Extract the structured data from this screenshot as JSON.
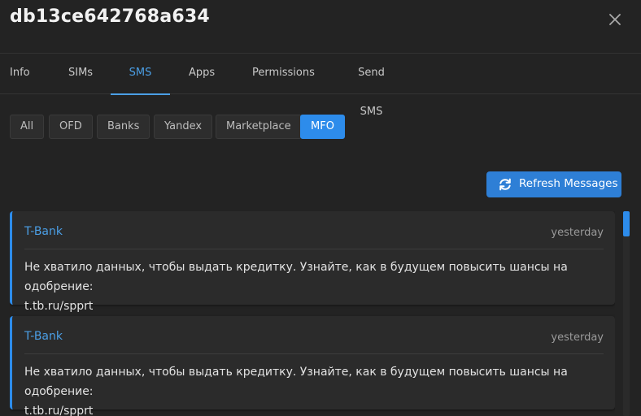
{
  "header": {
    "title": "db13ce642768a634"
  },
  "tabs": [
    {
      "label": "Info"
    },
    {
      "label": "SIMs"
    },
    {
      "label": "SMS"
    },
    {
      "label": "Apps"
    },
    {
      "label": "Permissions"
    },
    {
      "label": "Send SMS"
    }
  ],
  "active_tab": "SMS",
  "filters": [
    {
      "label": "All"
    },
    {
      "label": "OFD"
    },
    {
      "label": "Banks"
    },
    {
      "label": "Yandex"
    },
    {
      "label": "Marketplace"
    },
    {
      "label": "MFO"
    }
  ],
  "active_filter": "MFO",
  "refresh": {
    "label": "Refresh Messages",
    "icon": "refresh-icon"
  },
  "messages": [
    {
      "sender": "T-Bank",
      "time": "yesterday",
      "text_line1": "Не хватило данных, чтобы выдать кредитку. Узнайте, как в будущем повысить шансы на одобрение:",
      "text_line2": "t.tb.ru/spprt"
    },
    {
      "sender": "T-Bank",
      "time": "yesterday",
      "text_line1": "Не хватило данных, чтобы выдать кредитку. Узнайте, как в будущем повысить шансы на одобрение:",
      "text_line2": "t.tb.ru/spprt"
    }
  ],
  "colors": {
    "accent": "#2d8ceb",
    "background": "#232323",
    "card": "#2b2b2b"
  }
}
